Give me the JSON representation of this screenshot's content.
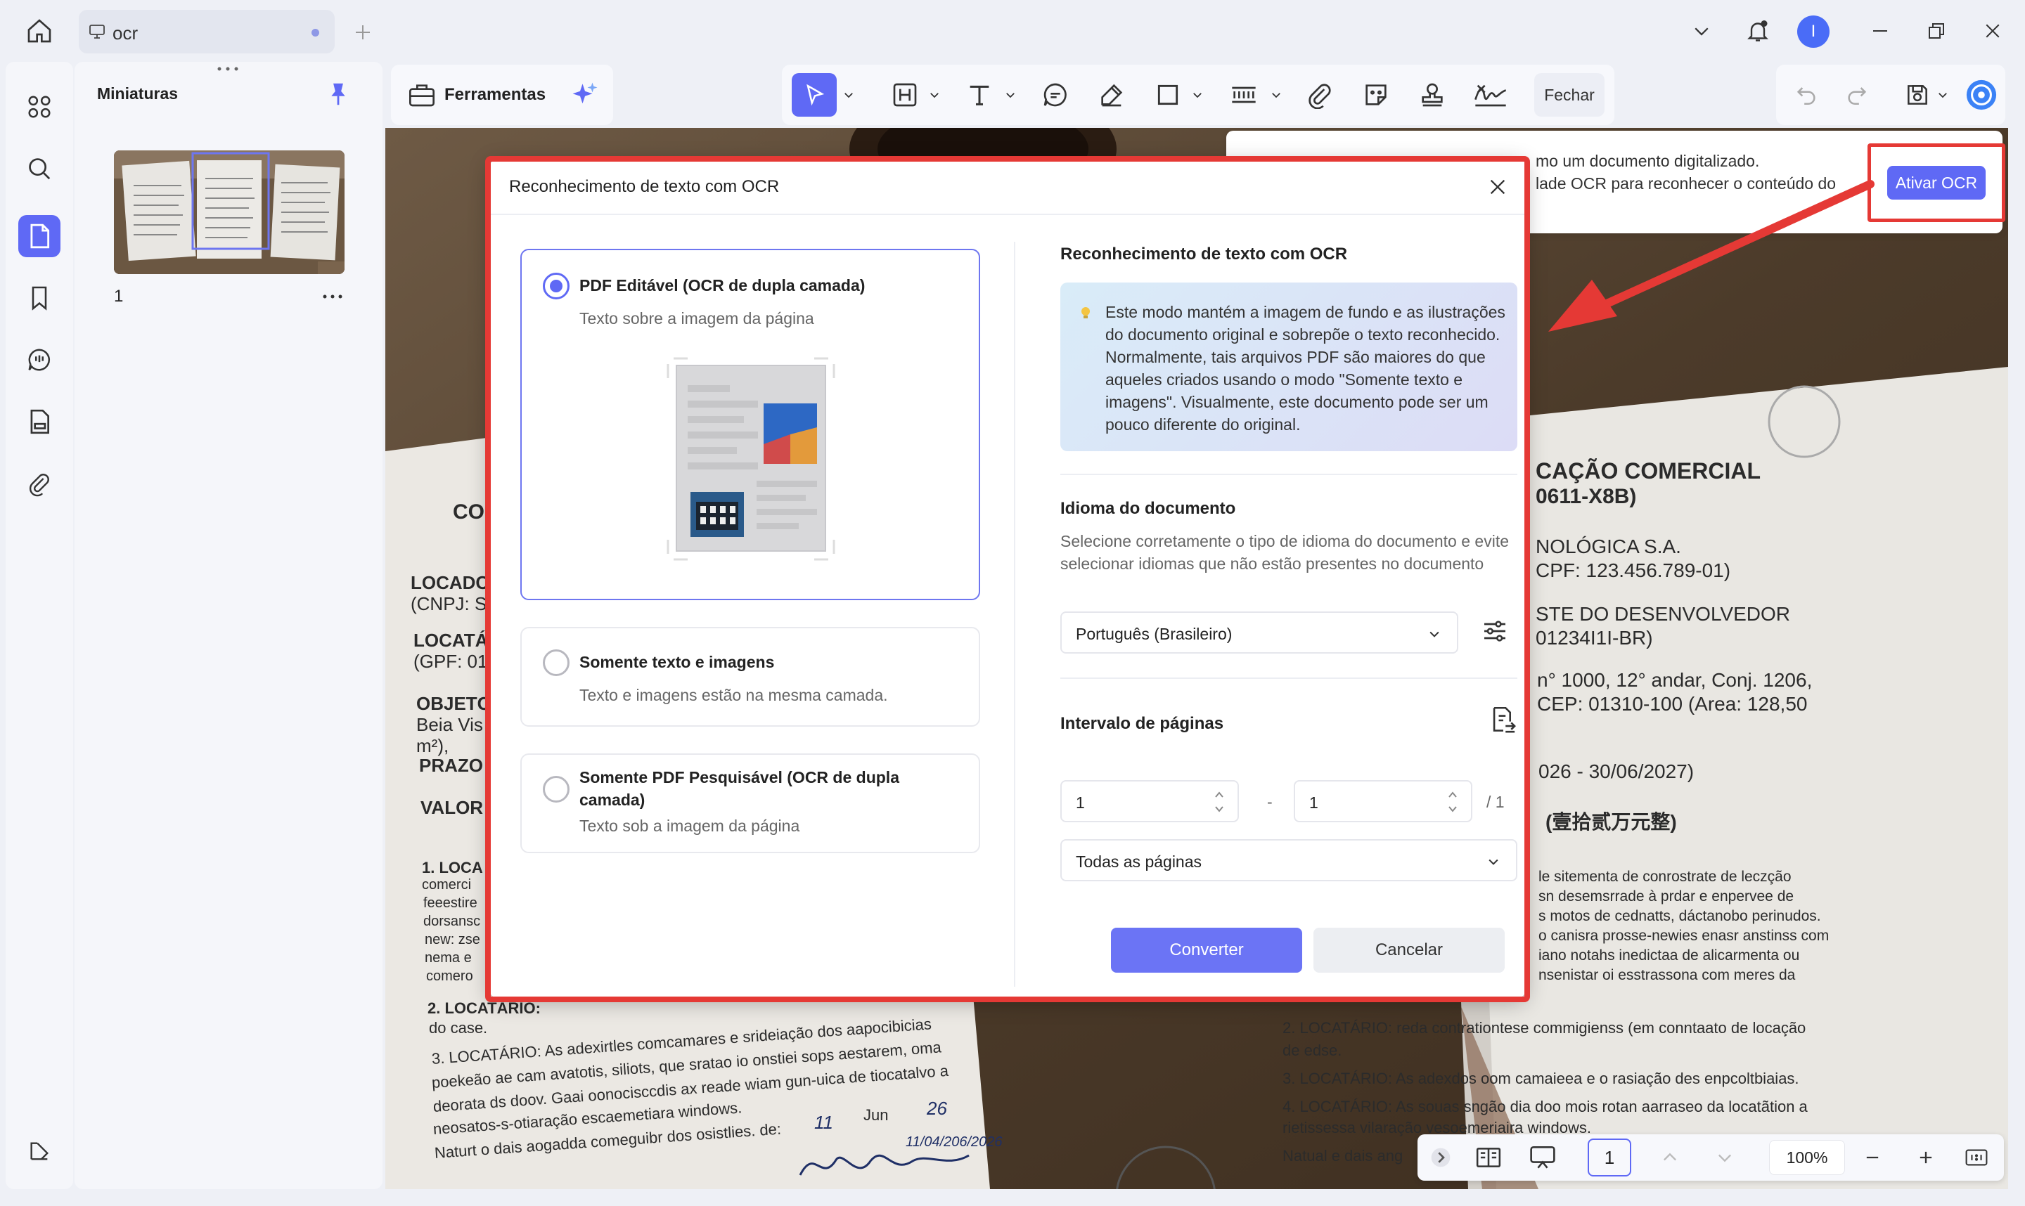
{
  "tab": {
    "label": "ocr"
  },
  "user": {
    "initial": "I"
  },
  "thumbnails": {
    "title": "Miniaturas",
    "page_number": "1"
  },
  "toolbar": {
    "tools_label": "Ferramentas",
    "close_label": "Fechar"
  },
  "notice": {
    "line1": "mo um documento digitalizado.",
    "line2": "lade OCR para reconhecer o conteúdo do",
    "button": "Ativar OCR"
  },
  "modal": {
    "title": "Reconhecimento de texto com OCR",
    "options": [
      {
        "title": "PDF Editável (OCR de dupla camada)",
        "subtitle": "Texto sobre a imagem da página",
        "selected": true
      },
      {
        "title": "Somente texto e imagens",
        "subtitle": "Texto e imagens estão na mesma camada.",
        "selected": false
      },
      {
        "title": "Somente PDF Pesquisável (OCR de dupla camada)",
        "subtitle": "Texto sob a imagem da página",
        "selected": false
      }
    ],
    "right": {
      "section_title": "Reconhecimento de texto com OCR",
      "info": "Este modo mantém a imagem de fundo e as ilustrações do documento original e sobrepõe o texto reconhecido. Normalmente, tais arquivos PDF são maiores do que aqueles criados usando o modo \"Somente texto e imagens\". Visualmente, este documento pode ser um pouco diferente do original.",
      "language_title": "Idioma do documento",
      "language_desc": "Selecione corretamente o tipo de idioma do documento e evite selecionar idiomas que não estão presentes no documento",
      "language_value": "Português (Brasileiro)",
      "range_title": "Intervalo de páginas",
      "range_from": "1",
      "range_dash": "-",
      "range_to": "1",
      "range_total": "/ 1",
      "range_option": "Todas as páginas"
    },
    "convert": "Converter",
    "cancel": "Cancelar"
  },
  "document": {
    "left_lines": [
      "CO",
      "LOCADC",
      "(CNPJ: S",
      "LOCATÁ",
      "(GPF: 01",
      "OBJETC",
      "Beia Vis",
      "m²),",
      "PRAZO",
      "VALOR",
      "1. LOCA",
      "comerci",
      "feeestire",
      "dorsansc",
      "new: zse",
      "nema e",
      "comero",
      "2. LOCATÁRIO:",
      "do case.",
      "3. LOCATÁRIO: As adexirtles comcamares e srideiação dos aapocibicias",
      "poekeão ae cam avatotis, siliots, que sratao io onstiei sops aestarem, oma",
      "deorata ds doov. Gaai oonocisccdis ax reade wiam gun-uica de tiocatalvo a",
      "neosatos-s-otiaração escaemetiara windows.",
      "Naturt o dais aogadda comeguibr dos osistlies. de:",
      "11",
      "Jun",
      "26"
    ],
    "right_lines": [
      "CAÇÃO COMERCIAL",
      "0611-X8B)",
      "NOLÓGICA S.A.",
      "CPF: 123.456.789-01)",
      "STE DO DESENVOLVEDOR",
      "01234I1I-BR)",
      "n° 1000, 12° andar, Conj. 1206,",
      "CEP: 01310-100 (Area: 128,50",
      "026 - 30/06/2027)",
      "(壹拾贰万元整)",
      "le sitementa de conrostrate de leczção",
      "sn desemsrrade à prdar e enpervee de",
      "s motos de cednatts, dáctanobo perinudos.",
      "o canisra prosse-newies enasr anstinss com",
      "iano notahs inedictaa de alicarmenta ou",
      "nsenistar oi esstrassona com meres da",
      "2. LOCATÁRIO: reda contrationtese commigienss (em conntaato de locação",
      "de edse.",
      "3. LOCATÁRIO: As adexdos oom camaieea e o rasiação des enpcoltbiaias.",
      "4. LOCATÁRIO: As souas sngão dia doo mois rotan aarraseo da locatãtion a",
      "rietissessa vilaração vesoemeriaira windows.",
      "Natual e dais ang"
    ],
    "signature": "11/04/206/2026"
  },
  "status": {
    "page": "1",
    "zoom": "100%"
  },
  "colors": {
    "accent": "#5f69f5",
    "highlight": "#e53935"
  }
}
